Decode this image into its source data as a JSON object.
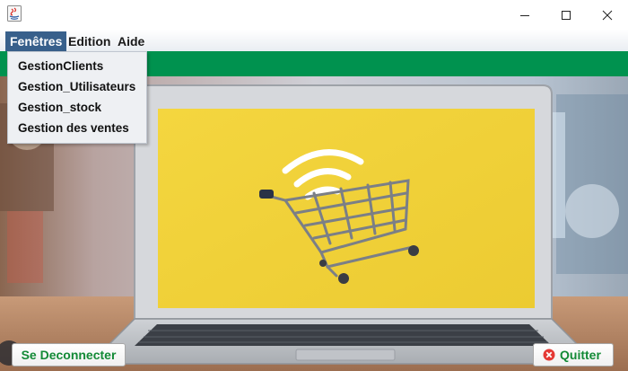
{
  "menubar": {
    "items": [
      "Fenêtres",
      "Edition",
      "Aide"
    ]
  },
  "fenetres_menu": {
    "items": [
      "GestionClients",
      "Gestion_Utilisateurs",
      "Gestion_stock",
      "Gestion des ventes"
    ]
  },
  "footer": {
    "disconnect_label": "Se Deconnecter",
    "quit_label": "Quitter"
  },
  "window_controls": [
    "minimize-icon",
    "maximize-icon",
    "close-icon"
  ],
  "colors": {
    "menu_active": "#38608b",
    "accent_green": "#00924f",
    "screen_yellow": "#f2d23c",
    "disconnect_text": "#138a36",
    "quit_icon": "#e53935"
  }
}
